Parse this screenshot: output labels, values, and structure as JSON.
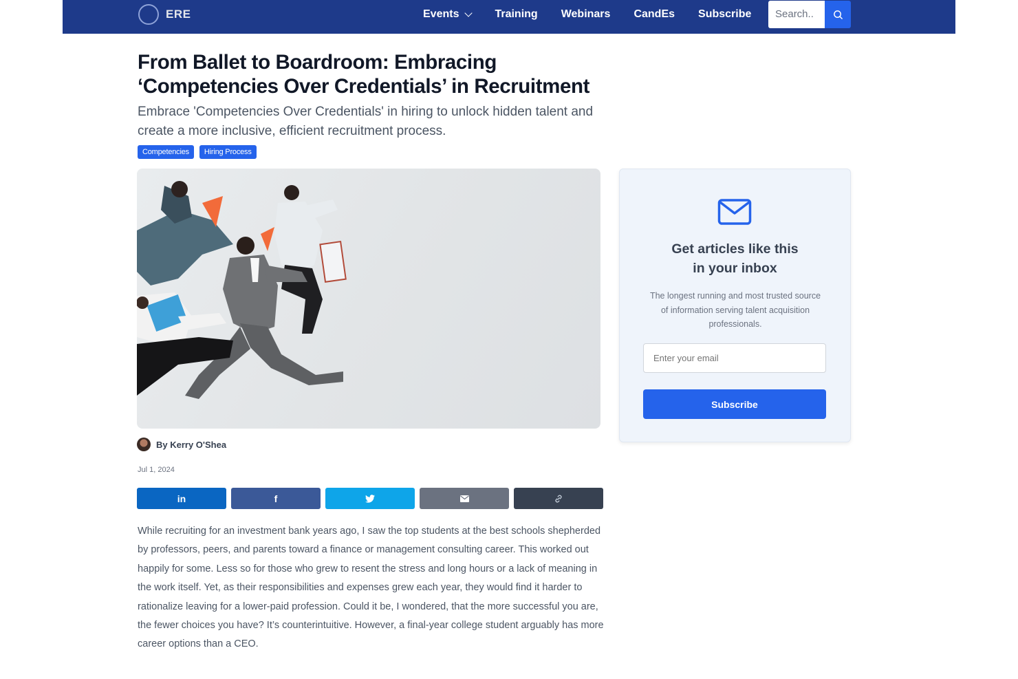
{
  "nav": {
    "logo_text": "ERE",
    "links": [
      {
        "label": "Events"
      },
      {
        "label": "Training"
      },
      {
        "label": "Webinars"
      },
      {
        "label": "CandEs"
      },
      {
        "label": "Subscribe"
      }
    ],
    "search_placeholder": "Search..",
    "icons": {
      "dropdown": "chevron-down-icon",
      "search": "search-icon"
    }
  },
  "article": {
    "title": "From Ballet to Boardroom: Embracing ‘Competencies Over Credentials’ in Recruitment",
    "subtitle": "Embrace 'Competencies Over Credentials' in hiring to unlock hidden talent and create a more inclusive, efficient recruitment process.",
    "tags": [
      "Competencies",
      "Hiring Process"
    ],
    "author": "By Kerry O'Shea",
    "date": "Jul 1, 2024",
    "body": "While recruiting for an investment bank years ago, I saw the top students at the best schools shepherded by professors, peers, and parents toward a finance or management consulting career. This worked out happily for some. Less so for those who grew to resent the stress and long hours or a lack of meaning in the work itself. Yet, as their responsibilities and expenses grew each year, they would find it harder to rationalize leaving for a lower-paid profession. Could it be, I wondered, that the more successful you are, the fewer choices you have? It’s counterintuitive. However, a final-year college student arguably has more career options than a CEO."
  },
  "share": [
    {
      "icon": "linkedin-icon",
      "glyph": "in",
      "color": "#0a66c2"
    },
    {
      "icon": "facebook-icon",
      "glyph": "f",
      "color": "#3b5998"
    },
    {
      "icon": "twitter-icon",
      "glyph": "🐦",
      "color": "#0ea5e9"
    },
    {
      "icon": "envelope-icon",
      "glyph": "✉",
      "color": "#6b7280"
    },
    {
      "icon": "link-icon",
      "glyph": "🔗",
      "color": "#374151"
    }
  ],
  "newsletter": {
    "icon": "envelope-icon",
    "title_line1": "Get articles like this",
    "title_line2": "in your inbox",
    "description": "The longest running and most trusted source of information serving talent acquisition professionals.",
    "email_placeholder": "Enter your email",
    "button_label": "Subscribe"
  },
  "colors": {
    "nav_bg": "#1e3a8a",
    "accent": "#2563eb",
    "card_bg": "#eff4fb"
  }
}
